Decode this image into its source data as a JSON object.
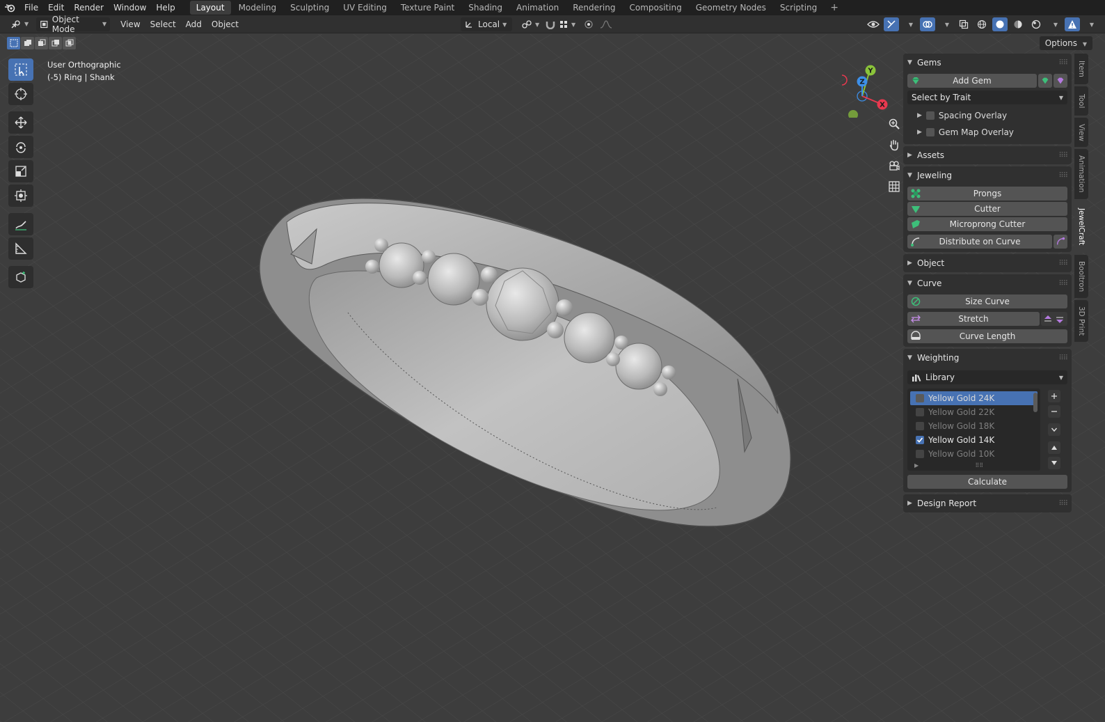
{
  "menubar": {
    "menus": [
      "File",
      "Edit",
      "Render",
      "Window",
      "Help"
    ],
    "workspaces": [
      "Layout",
      "Modeling",
      "Sculpting",
      "UV Editing",
      "Texture Paint",
      "Shading",
      "Animation",
      "Rendering",
      "Compositing",
      "Geometry Nodes",
      "Scripting"
    ],
    "active_workspace": "Layout",
    "add_symbol": "+"
  },
  "header": {
    "mode": "Object Mode",
    "menus": [
      "View",
      "Select",
      "Add",
      "Object"
    ],
    "orientation": "Local",
    "options_label": "Options"
  },
  "viewport": {
    "view_name": "User Orthographic",
    "context": "(-5) Ring | Shank",
    "gizmo": {
      "x": "X",
      "y": "Y",
      "z": "Z"
    }
  },
  "panels": {
    "gems": {
      "title": "Gems",
      "add_gem": "Add Gem",
      "select_by_trait": "Select by Trait",
      "spacing_overlay": "Spacing Overlay",
      "gem_map_overlay": "Gem Map Overlay"
    },
    "assets": {
      "title": "Assets"
    },
    "jeweling": {
      "title": "Jeweling",
      "prongs": "Prongs",
      "cutter": "Cutter",
      "microprong_cutter": "Microprong Cutter",
      "distribute_on_curve": "Distribute on Curve"
    },
    "object": {
      "title": "Object"
    },
    "curve": {
      "title": "Curve",
      "size_curve": "Size Curve",
      "stretch": "Stretch",
      "curve_length": "Curve Length"
    },
    "weighting": {
      "title": "Weighting",
      "library": "Library",
      "materials": [
        {
          "name": "Yellow Gold 24K",
          "checked": false,
          "active": true
        },
        {
          "name": "Yellow Gold 22K",
          "checked": false,
          "active": false
        },
        {
          "name": "Yellow Gold 18K",
          "checked": false,
          "active": false
        },
        {
          "name": "Yellow Gold 14K",
          "checked": true,
          "active": false
        },
        {
          "name": "Yellow Gold 10K",
          "checked": false,
          "active": false
        }
      ],
      "calculate": "Calculate"
    },
    "design_report": {
      "title": "Design Report"
    }
  },
  "side_tabs": [
    "Item",
    "Tool",
    "View",
    "Animation",
    "JewelCraft",
    "Booltron",
    "3D Print"
  ],
  "active_side_tab": "JewelCraft",
  "colors": {
    "accent": "#4772b3",
    "axis_x": "#e8394f",
    "axis_y": "#8bc43a",
    "axis_z": "#3d8fe8",
    "gem_green": "#3dbf7a"
  }
}
